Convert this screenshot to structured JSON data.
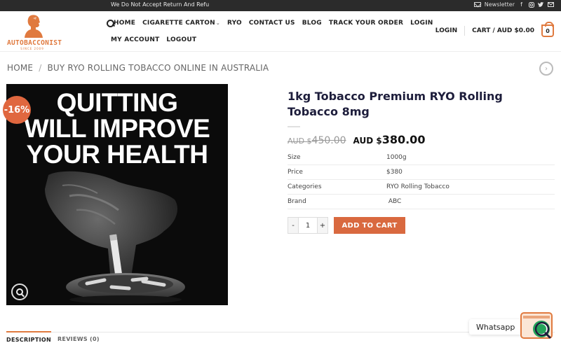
{
  "topbar": {
    "notice": "We Do Not Accept Return And Refu",
    "newsletter": "Newsletter"
  },
  "logo": {
    "name": "AUTOBACCONIST",
    "since": "SINCE 2009"
  },
  "nav": {
    "row1": [
      "HOME",
      "CIGARETTE CARTON",
      "RYO",
      "CONTACT US",
      "BLOG",
      "TRACK YOUR ORDER",
      "LOGIN"
    ],
    "row2": [
      "MY ACCOUNT",
      "LOGOUT"
    ]
  },
  "header_right": {
    "login": "LOGIN",
    "cart": "CART / AUD $0.00",
    "cart_count": "0"
  },
  "breadcrumb": {
    "home": "HOME",
    "divider": "/",
    "current": "BUY RYO ROLLING TOBACCO ONLINE IN AUSTRALIA"
  },
  "product": {
    "image_headline": [
      "QUITTING",
      "WILL IMPROVE",
      "YOUR HEALTH"
    ],
    "sale_badge": "-16%",
    "title": "1kg Tobacco Premium RYO Rolling Tobacco 8mg",
    "old_price_currency": "AUD $",
    "old_price": "450.00",
    "new_price_currency": "AUD $",
    "new_price": "380.00",
    "attributes": [
      {
        "key": "Size",
        "value": "1000g"
      },
      {
        "key": "Price",
        "value": "$380"
      },
      {
        "key": "Categories",
        "value": "RYO Rolling Tobacco"
      },
      {
        "key": "Brand",
        "value": " ABC"
      }
    ],
    "quantity": {
      "minus": "-",
      "value": "1",
      "plus": "+"
    },
    "add_to_cart": "ADD TO CART"
  },
  "tabs": [
    {
      "label": "DESCRIPTION",
      "active": true
    },
    {
      "label": "REVIEWS (0)",
      "active": false
    }
  ],
  "whatsapp": {
    "label": "Whatsapp"
  },
  "colors": {
    "accent": "#e07a3f",
    "button": "#d9693f",
    "topbar": "#2b2b2b",
    "badge": "#e0673f"
  }
}
